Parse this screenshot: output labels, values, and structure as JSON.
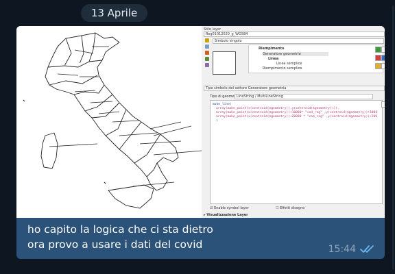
{
  "date_separator": "13 Aprile",
  "message": {
    "lines": [
      "ho capito la logica che ci sta dietro",
      "ora provo a usare i dati del covid"
    ],
    "time": "15:44",
    "status_icon": "double-check-read-icon"
  },
  "screenshot": {
    "panel_title": "Stile layer",
    "layer_combo": "Reg01012020_g_WGS84",
    "renderer_combo": "Simbolo singolo",
    "tree": {
      "root": "Riempimento",
      "gen": "Generatore geometria",
      "line": "Linea",
      "line_simple": "Linea semplice",
      "fill_simple": "Riempimento semplice"
    },
    "symbol_layer_type_label": "Tipo simbolo del settore Generatore geometria",
    "geom_type_label": "Tipo di geometria",
    "geom_type_value": "LineString / MultiLineString",
    "expression_lines": [
      "make_line(",
      "array(make_point(x(centroid($geometry)),y(centroid($geometry)))),",
      "array(make_point(x(centroid($geometry))+10000* \"cod_reg\" ,y(centroid($geometry))+1000",
      "array(make_point(x(centroid($geometry))+20000 * \"cod_reg\" ,y(centroid($geometry))+200",
      ")"
    ],
    "enable_label": "Enable symbol layer",
    "draw_effects_label": "Effetti disegno",
    "label_section": "Visualizzazione Layer"
  }
}
